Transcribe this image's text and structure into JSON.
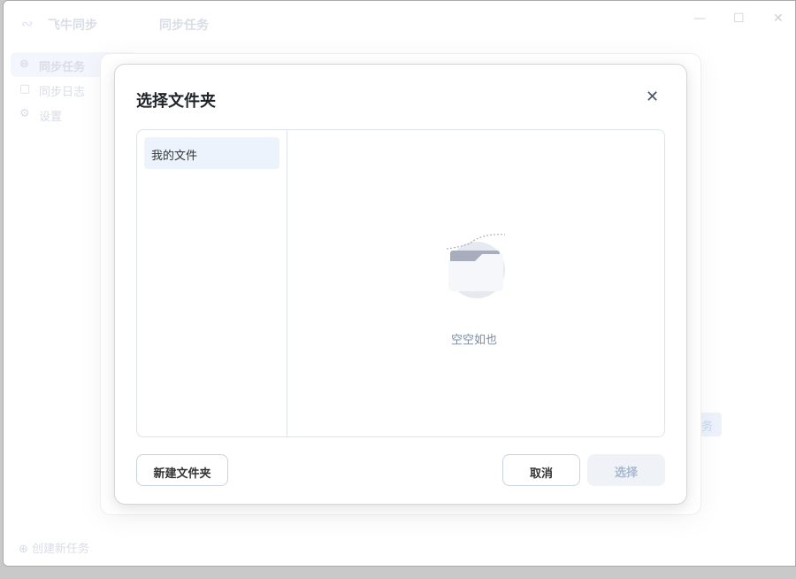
{
  "app": {
    "name": "飞牛同步",
    "page_title": "同步任务"
  },
  "sidebar": {
    "items": [
      {
        "label": "同步任务",
        "icon": "sync-circle-icon"
      },
      {
        "label": "同步日志",
        "icon": "note-icon"
      },
      {
        "label": "设置",
        "icon": "gear-icon"
      }
    ],
    "create_task": "创建新任务"
  },
  "background": {
    "partial_button": "务"
  },
  "dialog": {
    "title": "选择文件夹",
    "tree": [
      {
        "label": "我的文件"
      }
    ],
    "empty_text": "空空如也",
    "new_folder": "新建文件夹",
    "cancel": "取消",
    "select": "选择"
  }
}
